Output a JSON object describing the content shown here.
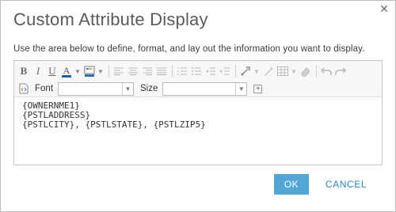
{
  "dialog": {
    "title": "Custom Attribute Display",
    "close_glyph": "✕",
    "instructions": "Use the area below to define, format, and lay out the information you want to display."
  },
  "toolbar": {
    "row1": [
      {
        "name": "bold-icon",
        "glyph": "B",
        "dim": false
      },
      {
        "name": "italic-icon",
        "glyph": "I",
        "dim": false
      },
      {
        "name": "underline-icon",
        "glyph": "U",
        "dim": false
      },
      {
        "name": "font-color-icon",
        "glyph": "A",
        "dim": false,
        "dropdown": true
      },
      {
        "name": "highlight-color-icon",
        "glyph": "▦",
        "dim": false,
        "dropdown": true
      },
      {
        "name": "align-left-icon",
        "glyph": "≡",
        "dim": true
      },
      {
        "name": "align-center-icon",
        "glyph": "≡",
        "dim": true
      },
      {
        "name": "align-right-icon",
        "glyph": "≡",
        "dim": true
      },
      {
        "name": "align-justify-icon",
        "glyph": "≡",
        "dim": true
      },
      {
        "name": "numbered-list-icon",
        "glyph": "☰",
        "dim": true
      },
      {
        "name": "bullet-list-icon",
        "glyph": "☰",
        "dim": true
      },
      {
        "name": "outdent-icon",
        "glyph": "⇤",
        "dim": true
      },
      {
        "name": "indent-icon",
        "glyph": "⇥",
        "dim": true
      },
      {
        "name": "link-icon",
        "glyph": "🔗",
        "dim": true,
        "dropdown": true
      },
      {
        "name": "insert-image-icon",
        "glyph": "✎",
        "dim": true
      },
      {
        "name": "table-icon",
        "glyph": "▤",
        "dim": true,
        "dropdown": true
      },
      {
        "name": "eraser-icon",
        "glyph": "✐",
        "dim": true
      },
      {
        "name": "undo-icon",
        "glyph": "↶",
        "dim": true
      },
      {
        "name": "redo-icon",
        "glyph": "↷",
        "dim": true
      }
    ],
    "source_icon": "source-view-icon",
    "font_label": "Font",
    "font_value": "",
    "size_label": "Size",
    "size_value": "",
    "add_glyph": "+"
  },
  "editor": {
    "lines": [
      "{OWNERNME1}",
      "{PSTLADDRESS}",
      "{PSTLCITY}, {PSTLSTATE}, {PSTLZIP5}"
    ]
  },
  "buttons": {
    "ok": "OK",
    "cancel": "CANCEL"
  },
  "colors": {
    "accent": "#54a6d6",
    "link": "#2f82bf"
  }
}
